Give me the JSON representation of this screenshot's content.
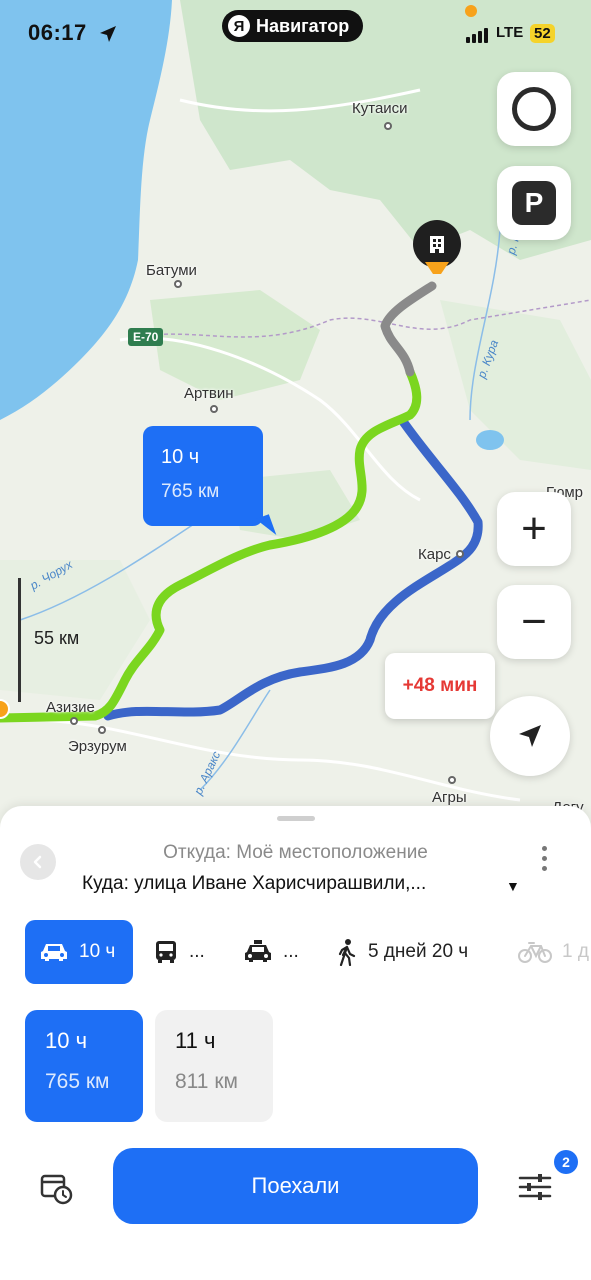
{
  "status_bar": {
    "time": "06:17",
    "app_pill": "Навигатор",
    "app_logo": "Я",
    "network": "LTE",
    "battery": "52"
  },
  "map": {
    "cities": {
      "kutaisi": "Кутаиси",
      "batumi": "Батуми",
      "artvin": "Артвин",
      "kars": "Карс",
      "azizie": "Азизие",
      "erzurum": "Эрзурум",
      "agri": "Агры",
      "gyumri": "Гюмр",
      "dogu": "Догу"
    },
    "rivers": {
      "chorukh": "р. Чорух",
      "kura1": "р. Кура",
      "kura2": "р. Кура",
      "araks": "р. Аракс"
    },
    "road_badge": "E-70",
    "scale_label": "55 км",
    "route_callout": {
      "time": "10 ч",
      "distance": "765 км"
    },
    "alt_callout": "+48 мин",
    "zoom_in": "+",
    "zoom_out": "−",
    "parking_label": "P",
    "route_colors": {
      "main": "#7bd61f",
      "alt": "#3b66c9",
      "start": "#8a8a8a"
    }
  },
  "sheet": {
    "from": "Откуда: Моё местоположение",
    "to": "Куда: улица Иване Харисчирашвили,...",
    "modes": {
      "car": "10 ч",
      "bus": "...",
      "taxi": "...",
      "walk": "5 дней 20 ч",
      "bike": "1 д"
    },
    "variants": [
      {
        "time": "10 ч",
        "distance": "765 км"
      },
      {
        "time": "11 ч",
        "distance": "811 км"
      }
    ],
    "go_button": "Поехали",
    "settings_badge": "2"
  }
}
